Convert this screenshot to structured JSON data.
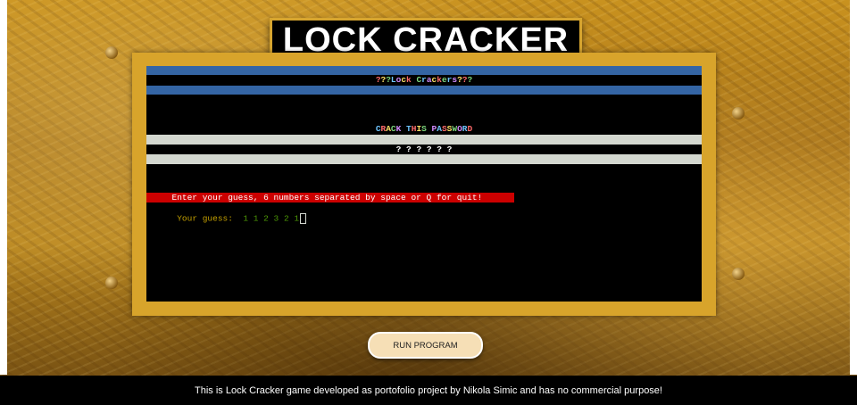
{
  "title": "LOCK CRACKER",
  "terminal": {
    "banner": "???Lock Crackers???",
    "crack_title": "CRACK THIS PASSWORD",
    "hidden_code": "? ? ? ? ? ?",
    "prompt": "     Enter your guess, 6 numbers separated by space or Q for quit!",
    "guess_label": "Your guess:  ",
    "guess_value": "1 1 2 3 2 1"
  },
  "run_button": "RUN PROGRAM",
  "footer": "This is Lock Cracker game developed as portofolio project by Nikola Simic and has no commercial purpose!",
  "colors": {
    "gold_frame": "#d8a42b",
    "terminal_bg": "#000000",
    "prompt_red": "#cc0000",
    "bar_blue": "#3465a4",
    "bar_gray": "#d3d7cf"
  }
}
